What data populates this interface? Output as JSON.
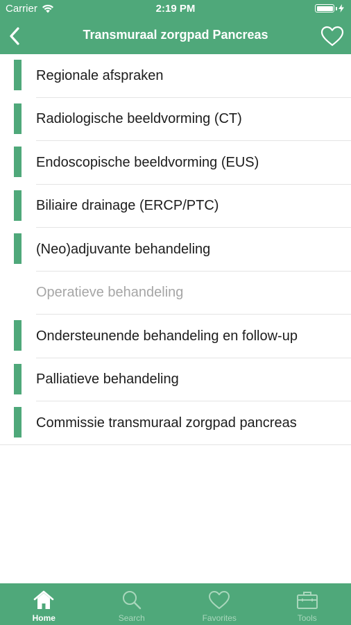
{
  "status_bar": {
    "carrier": "Carrier",
    "time": "2:19 PM"
  },
  "nav": {
    "title": "Transmuraal zorgpad Pancreas",
    "back_icon": "chevron-left-icon",
    "favorite_icon": "heart-icon"
  },
  "colors": {
    "accent": "#4fa87a",
    "text": "#1c1c1c",
    "disabled_text": "#a6a6a6",
    "inactive_tab": "#a9d7bc"
  },
  "list": {
    "items": [
      {
        "label": "Regionale afspraken",
        "enabled": true
      },
      {
        "label": "Radiologische beeldvorming (CT)",
        "enabled": true
      },
      {
        "label": "Endoscopische beeldvorming (EUS)",
        "enabled": true
      },
      {
        "label": "Biliaire drainage (ERCP/PTC)",
        "enabled": true
      },
      {
        "label": "(Neo)adjuvante behandeling",
        "enabled": true
      },
      {
        "label": "Operatieve behandeling",
        "enabled": false
      },
      {
        "label": "Ondersteunende behandeling en follow-up",
        "enabled": true
      },
      {
        "label": "Palliatieve behandeling",
        "enabled": true
      },
      {
        "label": "Commissie transmuraal zorgpad pancreas",
        "enabled": true
      }
    ]
  },
  "tab_bar": {
    "tabs": [
      {
        "label": "Home",
        "icon": "home-icon",
        "active": true
      },
      {
        "label": "Search",
        "icon": "search-icon",
        "active": false
      },
      {
        "label": "Favorites",
        "icon": "heart-icon",
        "active": false
      },
      {
        "label": "Tools",
        "icon": "toolbox-icon",
        "active": false
      }
    ]
  }
}
